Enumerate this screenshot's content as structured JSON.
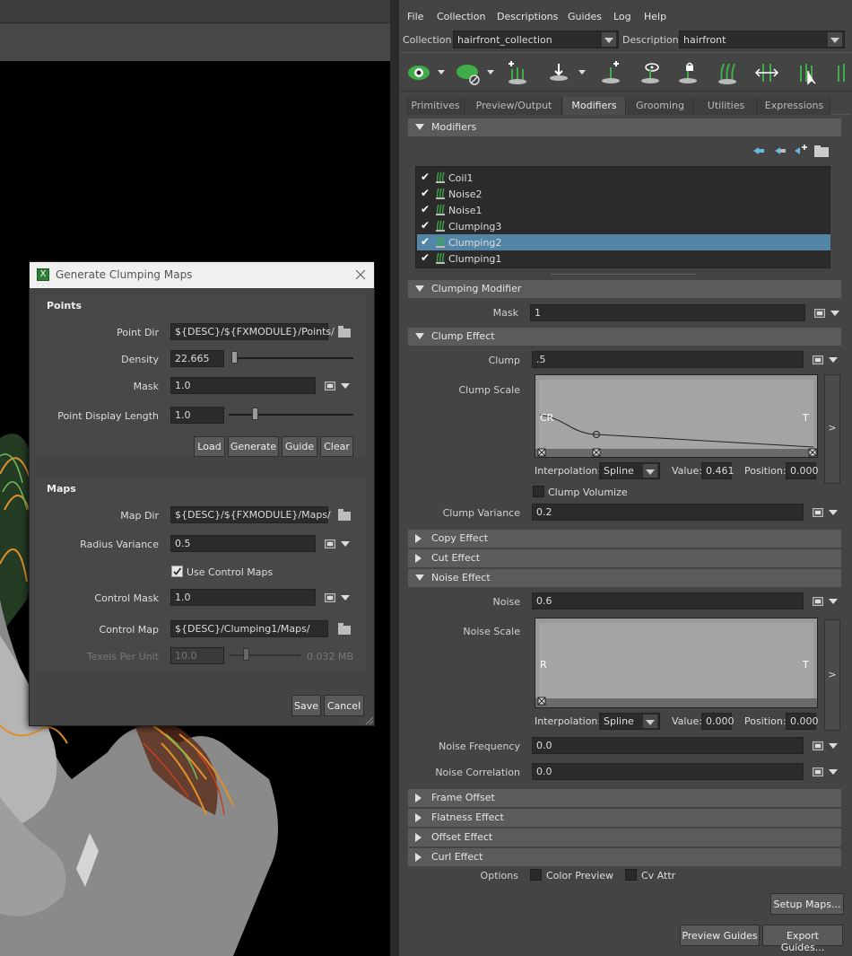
{
  "menu": [
    "File",
    "Collection",
    "Descriptions",
    "Guides",
    "Log",
    "Help"
  ],
  "collection_label": "Collection",
  "collection_value": "hairfront_collection",
  "description_label": "Description",
  "description_value": "hairfront",
  "tabs": [
    "Primitives",
    "Preview/Output",
    "Modifiers",
    "Grooming",
    "Utilities",
    "Expressions"
  ],
  "active_tab": "Modifiers",
  "modifiers_header": "Modifiers",
  "modifier_list": [
    {
      "label": "Coil1",
      "checked": true,
      "selected": false
    },
    {
      "label": "Noise2",
      "checked": true,
      "selected": false
    },
    {
      "label": "Noise1",
      "checked": true,
      "selected": false
    },
    {
      "label": "Clumping3",
      "checked": true,
      "selected": false
    },
    {
      "label": "Clumping2",
      "checked": true,
      "selected": true
    },
    {
      "label": "Clumping1",
      "checked": true,
      "selected": false
    }
  ],
  "clumping_modifier": {
    "header": "Clumping Modifier",
    "mask_label": "Mask",
    "mask_value": "1",
    "clump_effect_header": "Clump Effect",
    "clump_label": "Clump",
    "clump_value": ".5",
    "clump_scale_label": "Clump Scale",
    "curve_left": "CR",
    "curve_right": "T",
    "interp_label": "Interpolation:",
    "interp_value": "Spline",
    "value_label": "Value:",
    "value_value": "0.461",
    "position_label": "Position:",
    "position_value": "0.000",
    "clump_volumize": "Clump Volumize",
    "clump_variance_label": "Clump Variance",
    "clump_variance_value": "0.2",
    "copy_effect": "Copy Effect",
    "cut_effect": "Cut Effect",
    "noise_effect": "Noise Effect",
    "noise_label": "Noise",
    "noise_value": "0.6",
    "noise_scale_label": "Noise Scale",
    "noise_curve_left": "R",
    "noise_curve_right": "T",
    "noise_interp_value": "Spline",
    "noise_value_value": "0.000",
    "noise_position_value": "0.000",
    "noise_freq_label": "Noise Frequency",
    "noise_freq_value": "0.0",
    "noise_corr_label": "Noise Correlation",
    "noise_corr_value": "0.0",
    "frame_offset": "Frame Offset",
    "flatness_effect": "Flatness Effect",
    "offset_effect": "Offset Effect",
    "curl_effect": "Curl Effect",
    "options_label": "Options",
    "color_preview": "Color Preview",
    "cv_attr": "Cv Attr",
    "expand_arrow": ">"
  },
  "bottom_buttons": {
    "setup_maps": "Setup Maps...",
    "preview_guides": "Preview Guides",
    "export_guides": "Export Guides..."
  },
  "dialog": {
    "title": "Generate Clumping Maps",
    "points_header": "Points",
    "point_dir_label": "Point Dir",
    "point_dir_value": "${DESC}/${FXMODULE}/Points/",
    "density_label": "Density",
    "density_value": "22.665",
    "mask_label": "Mask",
    "mask_value": "1.0",
    "pdl_label": "Point Display Length",
    "pdl_value": "1.0",
    "load": "Load",
    "generate": "Generate",
    "guide": "Guide",
    "clear": "Clear",
    "maps_header": "Maps",
    "map_dir_label": "Map Dir",
    "map_dir_value": "${DESC}/${FXMODULE}/Maps/",
    "radius_variance_label": "Radius Variance",
    "radius_variance_value": "0.5",
    "use_control_maps": "Use Control Maps",
    "control_mask_label": "Control Mask",
    "control_mask_value": "1.0",
    "control_map_label": "Control Map",
    "control_map_value": "${DESC}/Clumping1/Maps/",
    "texels_label": "Texels Per Unit",
    "texels_value": "10.0",
    "texels_size": "0.032 MB",
    "save": "Save",
    "cancel": "Cancel"
  }
}
